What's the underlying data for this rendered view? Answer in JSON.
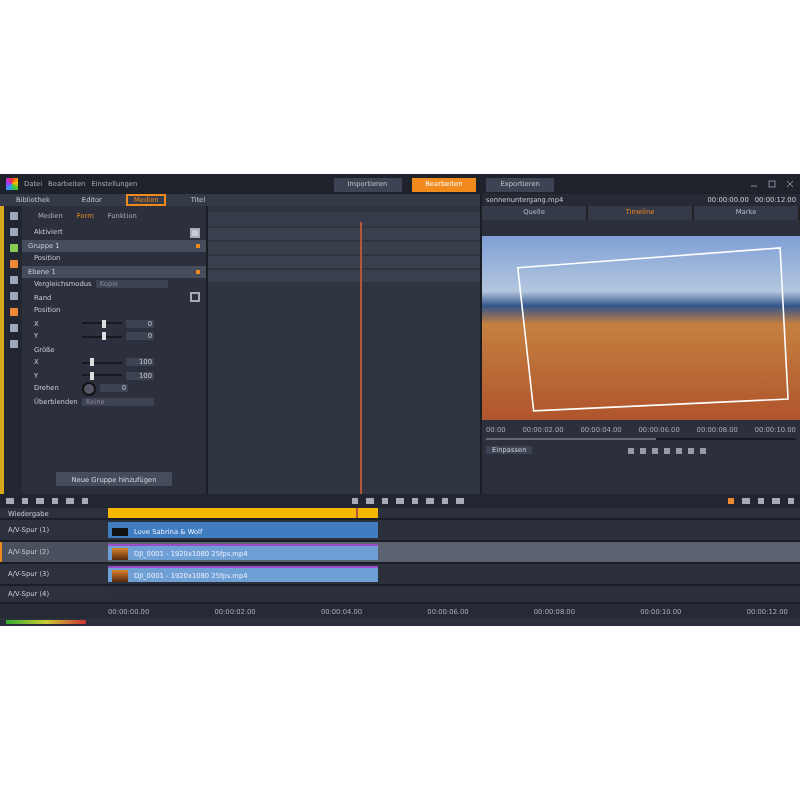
{
  "menu": [
    "Datei",
    "Bearbeiten",
    "Einstellungen"
  ],
  "main_tabs": [
    {
      "label": "Importieren",
      "selected": false
    },
    {
      "label": "Bearbeiten",
      "selected": true
    },
    {
      "label": "Exportieren",
      "selected": false
    }
  ],
  "panel_tabs": [
    {
      "label": "Bibliothek",
      "selected": false
    },
    {
      "label": "Editor",
      "selected": false
    },
    {
      "label": "Medien",
      "selected": true
    },
    {
      "label": "Titel",
      "selected": false
    }
  ],
  "sub_tabs": [
    {
      "label": "Medien",
      "selected": false
    },
    {
      "label": "Form",
      "selected": true
    },
    {
      "label": "Funktion",
      "selected": false
    }
  ],
  "properties": [
    {
      "kind": "check",
      "label": "Aktiviert",
      "checked": true
    },
    {
      "kind": "group",
      "label": "Gruppe 1"
    },
    {
      "kind": "section",
      "label": "Position"
    },
    {
      "kind": "group",
      "label": "Ebene 1"
    },
    {
      "kind": "select",
      "label": "Vergleichsmodus",
      "value": "Kopie"
    },
    {
      "kind": "check",
      "label": "Rand",
      "checked": false
    },
    {
      "kind": "section",
      "label": "Position"
    },
    {
      "kind": "slider",
      "label": "X",
      "value": "0",
      "level": 0.5
    },
    {
      "kind": "slider",
      "label": "Y",
      "value": "0",
      "level": 0.5
    },
    {
      "kind": "section",
      "label": "Größe"
    },
    {
      "kind": "slider",
      "label": "X",
      "value": "100",
      "level": 0.2
    },
    {
      "kind": "slider",
      "label": "Y",
      "value": "100",
      "level": 0.2
    },
    {
      "kind": "dial",
      "label": "Drehen",
      "value": "0"
    },
    {
      "kind": "select",
      "label": "Überblenden",
      "value": "Keine"
    }
  ],
  "add_group_button": "Neue Gruppe hinzufügen",
  "preview": {
    "file": "sonnenuntergang.mp4",
    "timecode_left": "00:00:00.00",
    "timecode_right": "00:00:12.00",
    "tabs": [
      {
        "label": "Quelle",
        "selected": false
      },
      {
        "label": "Timeline",
        "selected": true
      },
      {
        "label": "Marke",
        "selected": false
      }
    ],
    "ruler": [
      "00:00",
      "00:00:02.00",
      "00:00:04.00",
      "00:00:06.00",
      "00:00:08.00",
      "00:00:10.00"
    ],
    "zoom": "Einpassen",
    "level": 0.55
  },
  "tracks": [
    {
      "name": "Wiedergabe",
      "kind": "title"
    },
    {
      "name": "A/V-Spur (1)",
      "kind": "title_clip",
      "clip": "Love Sabrina & Wolf"
    },
    {
      "name": "A/V-Spur (2)",
      "kind": "video",
      "clip": "DJI_0001 - 1920x1080 25fps.mp4",
      "selected": true
    },
    {
      "name": "A/V-Spur (3)",
      "kind": "video",
      "clip": "DJI_0001 - 1920x1080 25fps.mp4",
      "selected": false
    },
    {
      "name": "A/V-Spur (4)",
      "kind": "empty"
    }
  ],
  "timeline_ruler": [
    "00:00:00.00",
    "00:00:02.00",
    "00:00:04.00",
    "00:00:06.00",
    "00:00:08.00",
    "00:00:10.00",
    "00:00:12.00"
  ]
}
